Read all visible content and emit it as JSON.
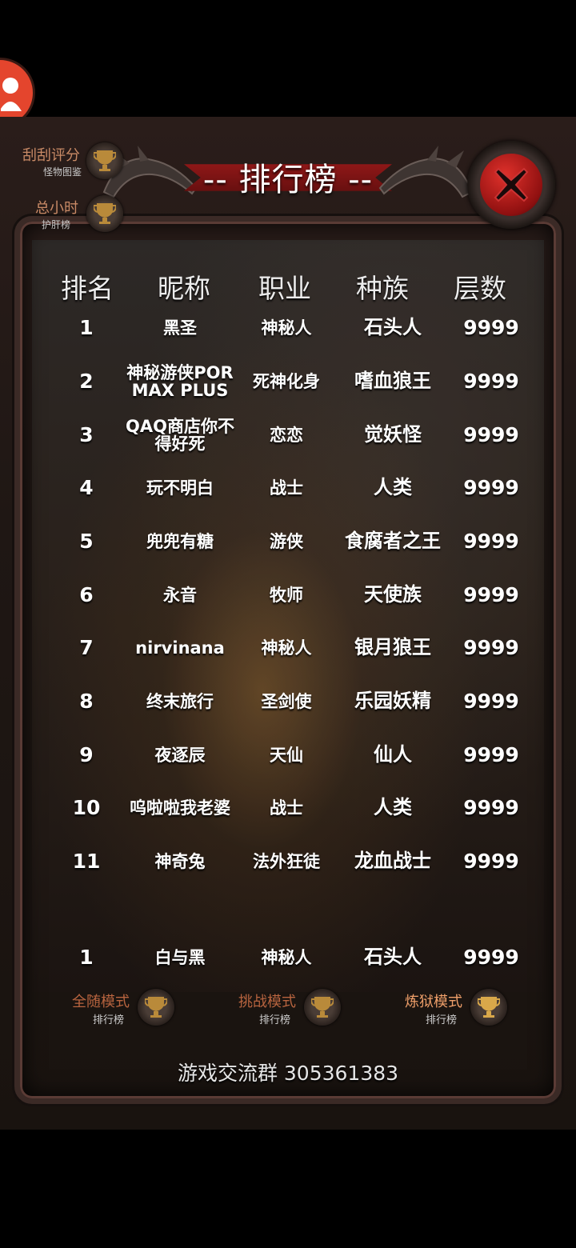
{
  "title": "-- 排行榜 --",
  "side_links": [
    {
      "main": "刮刮评分",
      "sub": "怪物图鉴"
    },
    {
      "main": "总小时",
      "sub": "护肝榜"
    }
  ],
  "headers": [
    "排名",
    "昵称",
    "职业",
    "种族",
    "层数"
  ],
  "rows": [
    {
      "rank": "1",
      "name": "黑圣",
      "job": "神秘人",
      "race": "石头人",
      "floor": "9999"
    },
    {
      "rank": "2",
      "name": "神秘游侠POR MAX PLUS",
      "job": "死神化身",
      "race": "嗜血狼王",
      "floor": "9999"
    },
    {
      "rank": "3",
      "name": "QAQ商店你不得好死",
      "job": "恋恋",
      "race": "觉妖怪",
      "floor": "9999"
    },
    {
      "rank": "4",
      "name": "玩不明白",
      "job": "战士",
      "race": "人类",
      "floor": "9999"
    },
    {
      "rank": "5",
      "name": "兜兜有糖",
      "job": "游侠",
      "race": "食腐者之王",
      "floor": "9999"
    },
    {
      "rank": "6",
      "name": "永音",
      "job": "牧师",
      "race": "天使族",
      "floor": "9999"
    },
    {
      "rank": "7",
      "name": "nirvinana",
      "job": "神秘人",
      "race": "银月狼王",
      "floor": "9999"
    },
    {
      "rank": "8",
      "name": "终末旅行",
      "job": "圣剑使",
      "race": "乐园妖精",
      "floor": "9999"
    },
    {
      "rank": "9",
      "name": "夜逐辰",
      "job": "天仙",
      "race": "仙人",
      "floor": "9999"
    },
    {
      "rank": "10",
      "name": "呜啦啦我老婆",
      "job": "战士",
      "race": "人类",
      "floor": "9999"
    },
    {
      "rank": "11",
      "name": "神奇兔",
      "job": "法外狂徒",
      "race": "龙血战士",
      "floor": "9999"
    }
  ],
  "my_row": {
    "rank": "1",
    "name": "白与黑",
    "job": "神秘人",
    "race": "石头人",
    "floor": "9999"
  },
  "modes": [
    {
      "main": "全随模式",
      "sub": "排行榜",
      "color": "#b8643f"
    },
    {
      "main": "挑战模式",
      "sub": "排行榜",
      "color": "#b8643f"
    },
    {
      "main": "炼狱模式",
      "sub": "排行榜",
      "color": "#f0a06a"
    }
  ],
  "footer": "游戏交流群 305361383",
  "colors": {
    "accent_red": "#e4452d",
    "link_orange": "#c98a66"
  },
  "icons": {
    "avatar": "user-icon",
    "close": "close-icon",
    "trophy": "trophy-icon"
  }
}
